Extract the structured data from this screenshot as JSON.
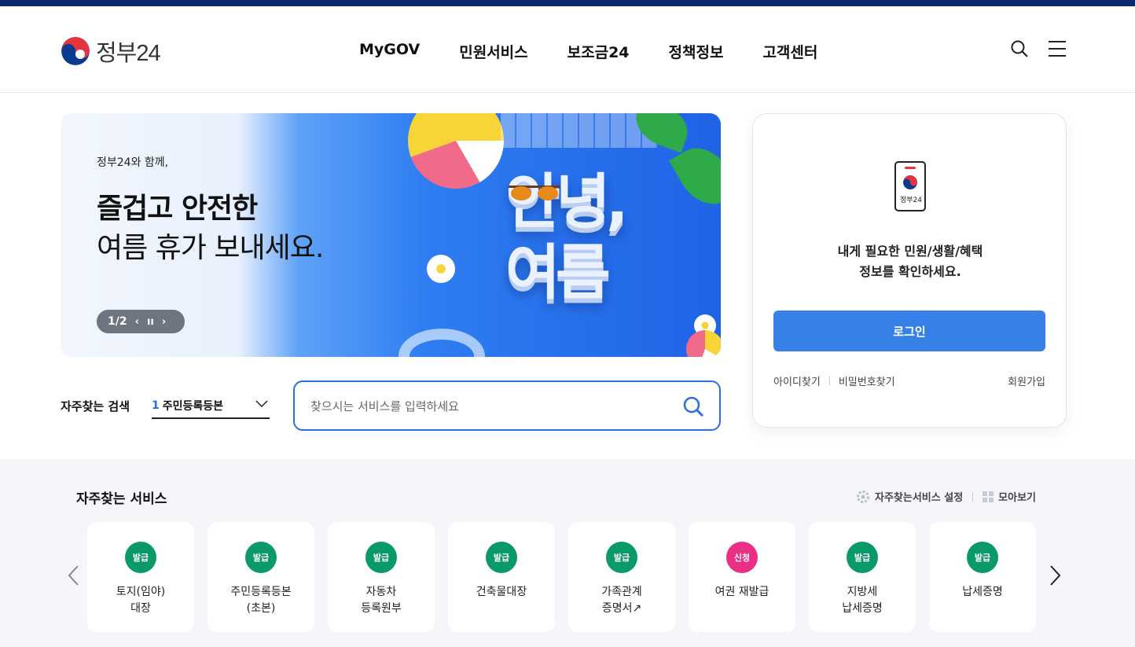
{
  "header": {
    "logo_text": "정부24",
    "nav": [
      "MyGOV",
      "민원서비스",
      "보조금24",
      "정책정보",
      "고객센터"
    ],
    "search_icon": "search-icon",
    "menu_icon": "hamburger-menu-icon"
  },
  "banner": {
    "small_text": "정부24와 함께,",
    "headline_bold": "즐겁고 안전한",
    "headline_regular": "여름 휴가 보내세요.",
    "art_line1": "안녕,",
    "art_line2": "여름",
    "pager": "1/2",
    "prev_icon": "chevron-left-icon",
    "pause_icon": "pause-icon",
    "next_icon": "chevron-right-icon"
  },
  "frequent_search": {
    "label": "자주찾는 검색",
    "selected_rank": "1",
    "selected_value": "주민등록등본"
  },
  "search": {
    "placeholder": "찾으시는 서비스를 입력하세요"
  },
  "login": {
    "phone_label": "정부24",
    "message_line1": "내게 필요한 민원/생활/혜택",
    "message_line2": "정보를 확인하세요.",
    "button": "로그인",
    "find_id": "아이디찾기",
    "find_pw": "비밀번호찾기",
    "join": "회원가입"
  },
  "services": {
    "title": "자주찾는 서비스",
    "settings_label": "자주찾는서비스 설정",
    "view_all_label": "모아보기",
    "items": [
      {
        "badge": "발급",
        "badge_color": "#0a9a6a",
        "label": "토지(임야)\n대장"
      },
      {
        "badge": "발급",
        "badge_color": "#0a9a6a",
        "label": "주민등록등본\n(초본)"
      },
      {
        "badge": "발급",
        "badge_color": "#0a9a6a",
        "label": "자동차\n등록원부"
      },
      {
        "badge": "발급",
        "badge_color": "#0a9a6a",
        "label": "건축물대장"
      },
      {
        "badge": "발급",
        "badge_color": "#0a9a6a",
        "label": "가족관계\n증명서↗"
      },
      {
        "badge": "신청",
        "badge_color": "#ea2f86",
        "label": "여권 재발급"
      },
      {
        "badge": "발급",
        "badge_color": "#0a9a6a",
        "label": "지방세\n납세증명"
      },
      {
        "badge": "발급",
        "badge_color": "#0a9a6a",
        "label": "납세증명"
      }
    ]
  },
  "colors": {
    "primary": "#3680e8",
    "top_bar": "#0b2a6b",
    "issue_badge": "#0a9a6a",
    "apply_badge": "#ea2f86"
  }
}
